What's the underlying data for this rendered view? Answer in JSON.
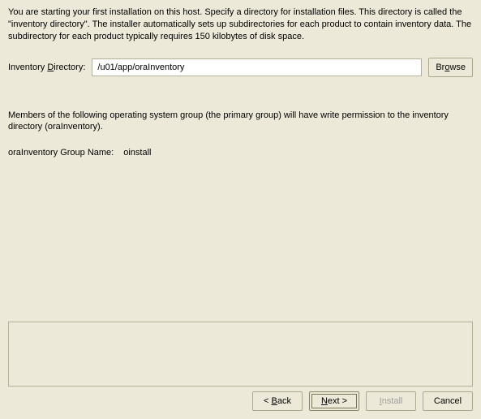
{
  "intro": "You are starting your first installation on this host. Specify a directory for installation files. This directory is called the \"inventory directory\". The installer automatically sets up subdirectories for each product to contain inventory data. The subdirectory for each product typically requires 150 kilobytes of disk space.",
  "directory": {
    "label_pre": "Inventory ",
    "label_u": "D",
    "label_post": "irectory:",
    "value": "/u01/app/oraInventory"
  },
  "browse": {
    "pre": "Br",
    "u": "o",
    "post": "wse"
  },
  "members_text": "Members of the following operating system group (the primary group) will have write permission to the inventory directory (oraInventory).",
  "group": {
    "label": "oraInventory Group Name:",
    "value": "oinstall"
  },
  "buttons": {
    "back_pre": "< ",
    "back_u": "B",
    "back_post": "ack",
    "next_u": "N",
    "next_post": "ext >",
    "install_u": "I",
    "install_post": "nstall",
    "cancel": "Cancel"
  }
}
